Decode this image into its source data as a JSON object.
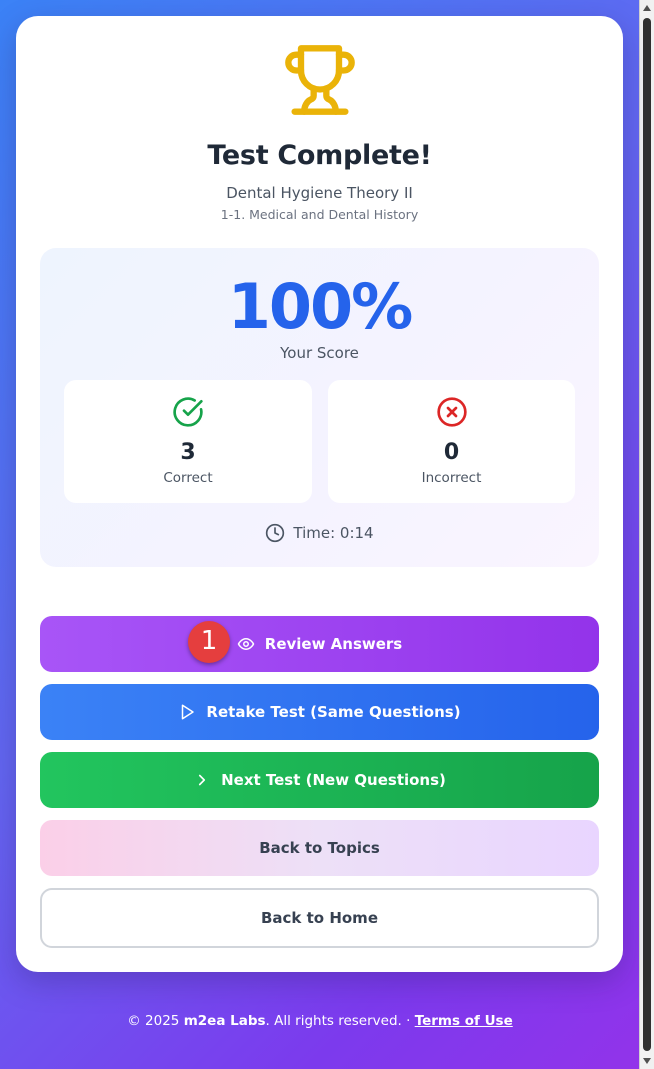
{
  "result": {
    "title": "Test Complete!",
    "subject": "Dental Hygiene Theory II",
    "topic": "1-1. Medical and Dental History"
  },
  "score": {
    "value": "100%",
    "label": "Your Score",
    "correct_count": "3",
    "correct_label": "Correct",
    "incorrect_count": "0",
    "incorrect_label": "Incorrect",
    "time_text": "Time: 0:14"
  },
  "actions": {
    "review": "Review Answers",
    "retake": "Retake Test (Same Questions)",
    "next": "Next Test (New Questions)",
    "topics": "Back to Topics",
    "home": "Back to Home"
  },
  "marker": {
    "label": "1"
  },
  "footer": {
    "prefix": "© 2025 ",
    "brand": "m2ea Labs",
    "rights": ". All rights reserved. · ",
    "terms": "Terms of Use"
  },
  "colors": {
    "trophy": "#eab308",
    "score": "#2563eb",
    "correct": "#16a34a",
    "incorrect": "#dc2626",
    "review": "#9333ea",
    "retake": "#2563eb",
    "next": "#16a34a"
  },
  "icons": {
    "header": "trophy-icon",
    "correct": "check-circle-icon",
    "incorrect": "x-circle-icon",
    "time": "clock-icon",
    "review": "eye-icon",
    "retake": "play-icon",
    "next": "chevron-right-icon"
  }
}
